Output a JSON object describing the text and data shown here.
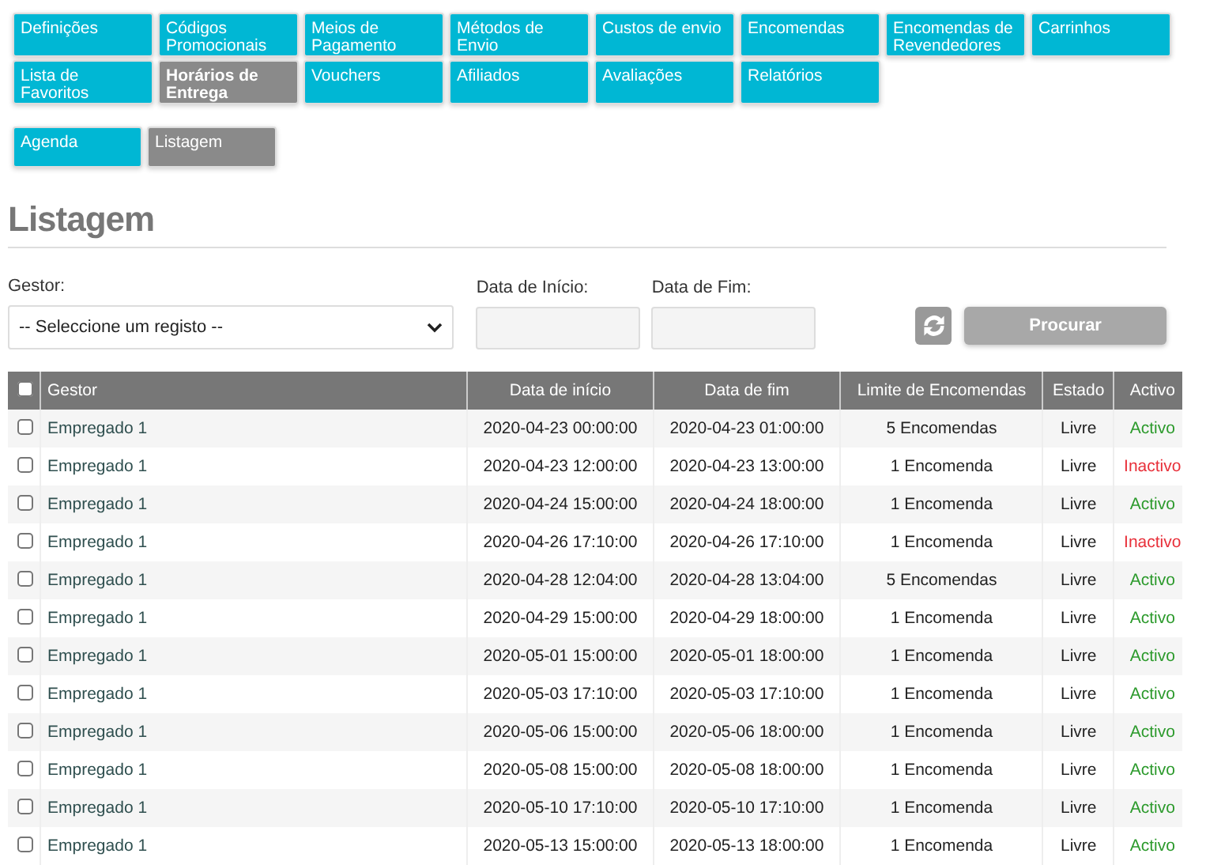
{
  "menu": [
    {
      "label": "Definições",
      "selected": false
    },
    {
      "label": "Códigos Promocionais",
      "selected": false
    },
    {
      "label": "Meios de Pagamento",
      "selected": false
    },
    {
      "label": "Métodos de Envio",
      "selected": false
    },
    {
      "label": "Custos de envio",
      "selected": false
    },
    {
      "label": "Encomendas",
      "selected": false
    },
    {
      "label": "Encomendas de Revendedores",
      "selected": false
    },
    {
      "label": "Carrinhos",
      "selected": false
    },
    {
      "label": "Lista de Favoritos",
      "selected": false
    },
    {
      "label": "Horários de Entrega",
      "selected": true
    },
    {
      "label": "Vouchers",
      "selected": false
    },
    {
      "label": "Afiliados",
      "selected": false
    },
    {
      "label": "Avaliações",
      "selected": false
    },
    {
      "label": "Relatórios",
      "selected": false
    }
  ],
  "subtabs": [
    {
      "label": "Agenda",
      "selected": false
    },
    {
      "label": "Listagem",
      "selected": true
    }
  ],
  "title": "Listagem",
  "filters": {
    "manager_label": "Gestor:",
    "manager_value": "-- Seleccione um registo --",
    "start_label": "Data de Início:",
    "end_label": "Data de Fim:",
    "search_button": "Procurar"
  },
  "table": {
    "select_all_checked": false,
    "columns": [
      "Gestor",
      "Data de início",
      "Data de fim",
      "Limite de Encomendas",
      "Estado",
      "Activo"
    ],
    "rows": [
      {
        "checked": false,
        "cells": [
          "Empregado 1",
          "2020-04-23 00:00:00",
          "2020-04-23 01:00:00",
          "5 Encomendas",
          "Livre"
        ],
        "active": true,
        "active_text": "Activo"
      },
      {
        "checked": false,
        "cells": [
          "Empregado 1",
          "2020-04-23 12:00:00",
          "2020-04-23 13:00:00",
          "1 Encomenda",
          "Livre"
        ],
        "active": false,
        "active_text": "Inactivo"
      },
      {
        "checked": false,
        "cells": [
          "Empregado 1",
          "2020-04-24 15:00:00",
          "2020-04-24 18:00:00",
          "1 Encomenda",
          "Livre"
        ],
        "active": true,
        "active_text": "Activo"
      },
      {
        "checked": false,
        "cells": [
          "Empregado 1",
          "2020-04-26 17:10:00",
          "2020-04-26 17:10:00",
          "1 Encomenda",
          "Livre"
        ],
        "active": false,
        "active_text": "Inactivo"
      },
      {
        "checked": false,
        "cells": [
          "Empregado 1",
          "2020-04-28 12:04:00",
          "2020-04-28 13:04:00",
          "5 Encomendas",
          "Livre"
        ],
        "active": true,
        "active_text": "Activo"
      },
      {
        "checked": false,
        "cells": [
          "Empregado 1",
          "2020-04-29 15:00:00",
          "2020-04-29 18:00:00",
          "1 Encomenda",
          "Livre"
        ],
        "active": true,
        "active_text": "Activo"
      },
      {
        "checked": false,
        "cells": [
          "Empregado 1",
          "2020-05-01 15:00:00",
          "2020-05-01 18:00:00",
          "1 Encomenda",
          "Livre"
        ],
        "active": true,
        "active_text": "Activo"
      },
      {
        "checked": false,
        "cells": [
          "Empregado 1",
          "2020-05-03 17:10:00",
          "2020-05-03 17:10:00",
          "1 Encomenda",
          "Livre"
        ],
        "active": true,
        "active_text": "Activo"
      },
      {
        "checked": false,
        "cells": [
          "Empregado 1",
          "2020-05-06 15:00:00",
          "2020-05-06 18:00:00",
          "1 Encomenda",
          "Livre"
        ],
        "active": true,
        "active_text": "Activo"
      },
      {
        "checked": false,
        "cells": [
          "Empregado 1",
          "2020-05-08 15:00:00",
          "2020-05-08 18:00:00",
          "1 Encomenda",
          "Livre"
        ],
        "active": true,
        "active_text": "Activo"
      },
      {
        "checked": false,
        "cells": [
          "Empregado 1",
          "2020-05-10 17:10:00",
          "2020-05-10 17:10:00",
          "1 Encomenda",
          "Livre"
        ],
        "active": true,
        "active_text": "Activo"
      },
      {
        "checked": false,
        "cells": [
          "Empregado 1",
          "2020-05-13 15:00:00",
          "2020-05-13 18:00:00",
          "1 Encomenda",
          "Livre"
        ],
        "active": true,
        "active_text": "Activo"
      }
    ]
  }
}
